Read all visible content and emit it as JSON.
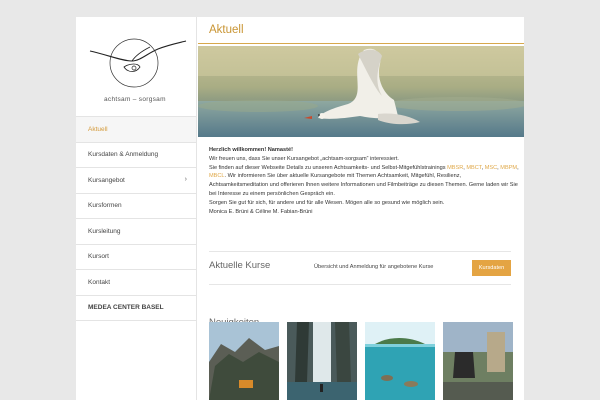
{
  "logo": {
    "text": "achtsam – sorgsam"
  },
  "nav": [
    {
      "label": "Aktuell",
      "active": true,
      "bold": false,
      "chevron": false
    },
    {
      "label": "Kursdaten & Anmeldung",
      "active": false,
      "bold": false,
      "chevron": false
    },
    {
      "label": "Kursangebot",
      "active": false,
      "bold": false,
      "chevron": true
    },
    {
      "label": "Kursformen",
      "active": false,
      "bold": false,
      "chevron": false
    },
    {
      "label": "Kursleitung",
      "active": false,
      "bold": false,
      "chevron": false
    },
    {
      "label": "Kursort",
      "active": false,
      "bold": false,
      "chevron": false
    },
    {
      "label": "Kontakt",
      "active": false,
      "bold": false,
      "chevron": false
    },
    {
      "label": "MEDEA CENTER BASEL",
      "active": false,
      "bold": true,
      "chevron": false
    }
  ],
  "nav_chevron_glyph": "›",
  "main": {
    "heading": "Aktuell",
    "welcome": "Herzlich willkommen!  Namasté!",
    "p1": "Wir freuen uns, dass Sie unser Kursangebot  „achtsam-sorgsam“ interessiert.",
    "p2a": "Sie finden auf dieser Webseite Details zu unseren Achtsamkeits- und Selbst-Mitgefühlstrainings ",
    "link_mbsr": "MBSR",
    "comma": ",",
    "link_mbct": "MBCT",
    "link_msc": "MSC",
    "link_mbpm": "MBPM",
    "link_mbcl": "MBCL",
    "p2b": ".  Wir informieren Sie über aktuelle Kursangebote mit Themen Achtsamkeit, Mitgefühl, Resilienz, Achtsamkeitsmeditation und offerieren Ihnen weitere Informationen und Filmbeiträge zu diesen Themen. Gerne laden wir Sie bei Interesse zu einem persönlichen  Gespräch ein.",
    "p3": "Sorgen Sie gut für sich, für andere und für alle Wesen. Mögen alle so gesund wie möglich sein.",
    "p4": "Monica E. Brüni & Céline M. Fabian-Brüni",
    "kurse_title": "Aktuelle Kurse",
    "kurse_desc": "Übersicht und Anmeldung für angebotene Kurse",
    "kurse_button": "Kursdaten",
    "news_title": "Neuigkeiten"
  },
  "colors": {
    "accent": "#d49a3a",
    "button": "#e4a443"
  }
}
